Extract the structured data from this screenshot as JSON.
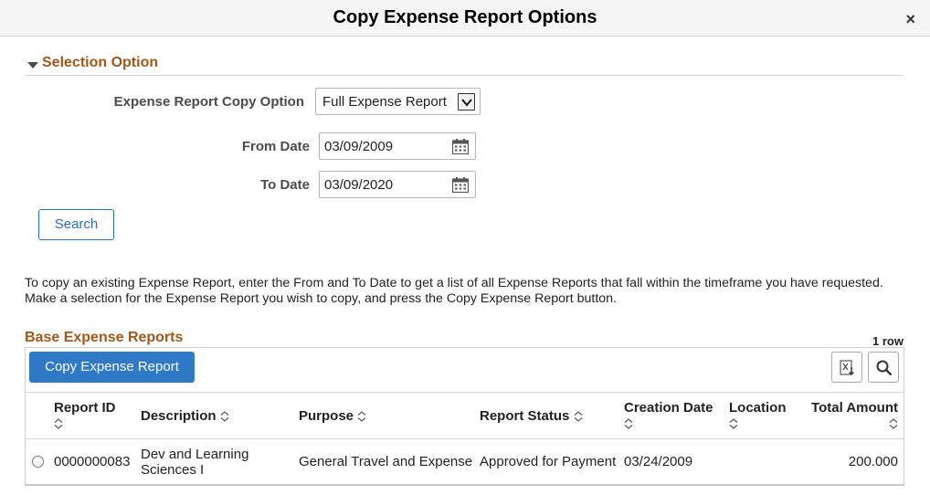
{
  "dialog": {
    "title": "Copy Expense Report Options",
    "close_label": "×"
  },
  "selection": {
    "section_title": "Selection Option",
    "copy_option_label": "Expense Report Copy Option",
    "copy_option_value": "Full Expense Report",
    "from_date_label": "From Date",
    "from_date_value": "03/09/2009",
    "to_date_label": "To Date",
    "to_date_value": "03/09/2020",
    "search_label": "Search"
  },
  "instructions": {
    "line1": "To copy an existing Expense Report, enter the From and To Date to get a list of all Expense Reports that fall within the timeframe you have requested.",
    "line2": "Make a selection for the Expense Report you wish to copy, and press the Copy Expense Report button."
  },
  "grid": {
    "title": "Base Expense Reports",
    "row_count": "1 row",
    "copy_button_label": "Copy Expense Report",
    "icons": [
      "export-excel-icon",
      "search-icon"
    ],
    "columns": [
      "Report ID",
      "Description",
      "Purpose",
      "Report Status",
      "Creation Date",
      "Location",
      "Total Amount"
    ],
    "rows": [
      {
        "report_id": "0000000083",
        "description_line1": "Dev and Learning",
        "description_line2": "Sciences I",
        "purpose": "General Travel and Expense",
        "status": "Approved for Payment",
        "creation_date": "03/24/2009",
        "location": "",
        "total_amount": "200.000"
      }
    ]
  },
  "colors": {
    "section_title": "#a0571a",
    "primary_button": "#2f79c6",
    "link_blue": "#2d6fb3"
  }
}
